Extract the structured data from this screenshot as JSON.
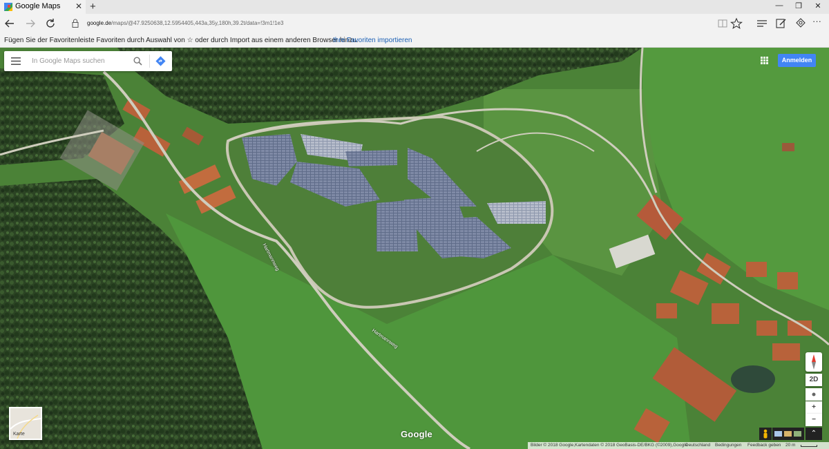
{
  "browser": {
    "tab_title": "Google Maps",
    "tab_close": "✕",
    "new_tab": "+",
    "url_host": "google.de",
    "url_rest": "/maps/@47.9250638,12.5954405,443a,35y,180h,39.2t/data=!3m1!1e3",
    "favorites_prompt": "Fügen Sie der Favoritenleiste Favoriten durch Auswahl von ☆ oder durch Import aus einem anderen Browser hinzu.",
    "favorites_link": "Ihre Favoriten importieren",
    "window_controls": [
      "—",
      "❐",
      "✕"
    ],
    "more_label": "···"
  },
  "maps": {
    "search_placeholder": "In Google Maps suchen",
    "signin_label": "Anmelden",
    "layer_label": "Karte",
    "logo_text": "Google",
    "view_toggle": "2D",
    "zoom_in": "+",
    "zoom_out": "−",
    "expand": "⌃",
    "road_labels": [
      "Hartmannweg",
      "Hartmannweg"
    ],
    "footer": {
      "imagery": "Bilder © 2018 Google,Kartendaten © 2018 GeoBasis-DE/BKG (©2009),Google",
      "country": "Deutschland",
      "terms": "Bedingungen",
      "feedback": "Feedback geben",
      "scale": "20 m"
    }
  },
  "colors": {
    "accent": "#4285f4",
    "link": "#1a5fb4",
    "forest": "#2f4a26",
    "meadow": "#4f8a3a",
    "solar": "#6d7a96",
    "roof": "#b8623a"
  }
}
